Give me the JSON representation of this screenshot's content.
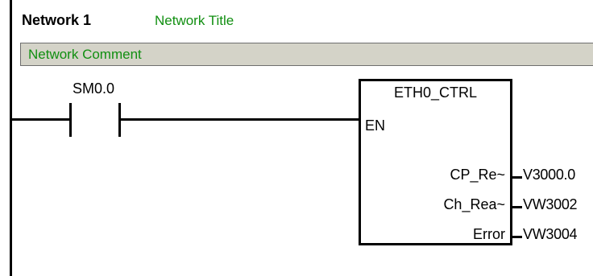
{
  "network": {
    "label": "Network 1",
    "title": "Network Title",
    "comment": "Network Comment"
  },
  "contact": {
    "address": "SM0.0"
  },
  "function_block": {
    "name": "ETH0_CTRL",
    "enable_pin": "EN",
    "outputs": [
      {
        "pin": "CP_Re~",
        "value": "V3000.0"
      },
      {
        "pin": "Ch_Rea~",
        "value": "VW3002"
      },
      {
        "pin": "Error",
        "value": "VW3004"
      }
    ]
  },
  "colors": {
    "title_green": "#118f11",
    "comment_bar": "#d4d3c8",
    "wire": "#000000"
  }
}
